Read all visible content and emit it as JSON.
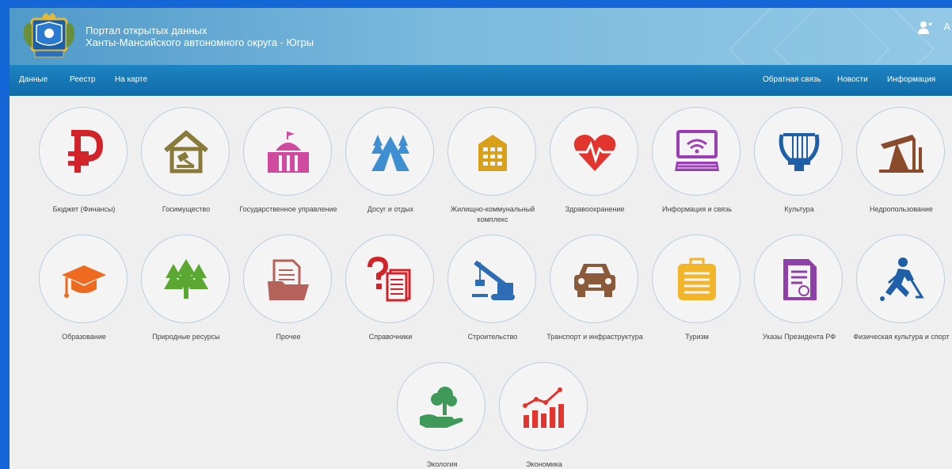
{
  "header": {
    "title_line1": "Портал открытых данных",
    "title_line2": "Ханты-Мансийского автономного округа - Югры",
    "lang_glyph": "A"
  },
  "nav": {
    "left": [
      "Данные",
      "Реестр",
      "На карте"
    ],
    "right": [
      "Обратная связь",
      "Новости",
      "Информация"
    ]
  },
  "categories": [
    {
      "label": "Бюджет (Финансы)",
      "icon": "ruble-icon",
      "color": "#d2232a"
    },
    {
      "label": "Госимущество",
      "icon": "house-gavel-icon",
      "color": "#8a7a3a"
    },
    {
      "label": "Государственное управление",
      "icon": "government-building-icon",
      "color": "#d04aa0"
    },
    {
      "label": "Досуг и отдых",
      "icon": "tent-trees-icon",
      "color": "#3d8fd1"
    },
    {
      "label": "Жилищно-коммунальный комплекс",
      "icon": "apartment-building-icon",
      "color": "#d9a11a"
    },
    {
      "label": "Здравоохранение",
      "icon": "heart-pulse-icon",
      "color": "#e2352e"
    },
    {
      "label": "Информация и связь",
      "icon": "wifi-computer-icon",
      "color": "#9b3fb5"
    },
    {
      "label": "Культура",
      "icon": "lyre-icon",
      "color": "#1f5fa8"
    },
    {
      "label": "Недропользование",
      "icon": "oil-pump-icon",
      "color": "#8a4b2a"
    },
    {
      "label": "Образование",
      "icon": "graduation-cap-icon",
      "color": "#ee6a1f"
    },
    {
      "label": "Природные ресурсы",
      "icon": "pine-trees-icon",
      "color": "#5aa832"
    },
    {
      "label": "Прочее",
      "icon": "folder-documents-icon",
      "color": "#b5625a"
    },
    {
      "label": "Справочники",
      "icon": "question-documents-icon",
      "color": "#d2232a"
    },
    {
      "label": "Строительство",
      "icon": "crane-icon",
      "color": "#2e6db5"
    },
    {
      "label": "Транспорт и инфраструктура",
      "icon": "car-icon",
      "color": "#8a5a3a"
    },
    {
      "label": "Туризм",
      "icon": "suitcase-icon",
      "color": "#f2b52a"
    },
    {
      "label": "Указы Президента РФ",
      "icon": "decree-document-icon",
      "color": "#8e3fa8"
    },
    {
      "label": "Физическая культура и спорт",
      "icon": "hockey-player-icon",
      "color": "#1f5fa8"
    },
    {
      "label": "Экология",
      "icon": "tree-hand-icon",
      "color": "#3f9a5a"
    },
    {
      "label": "Экономика",
      "icon": "growth-chart-icon",
      "color": "#e2352e"
    }
  ]
}
